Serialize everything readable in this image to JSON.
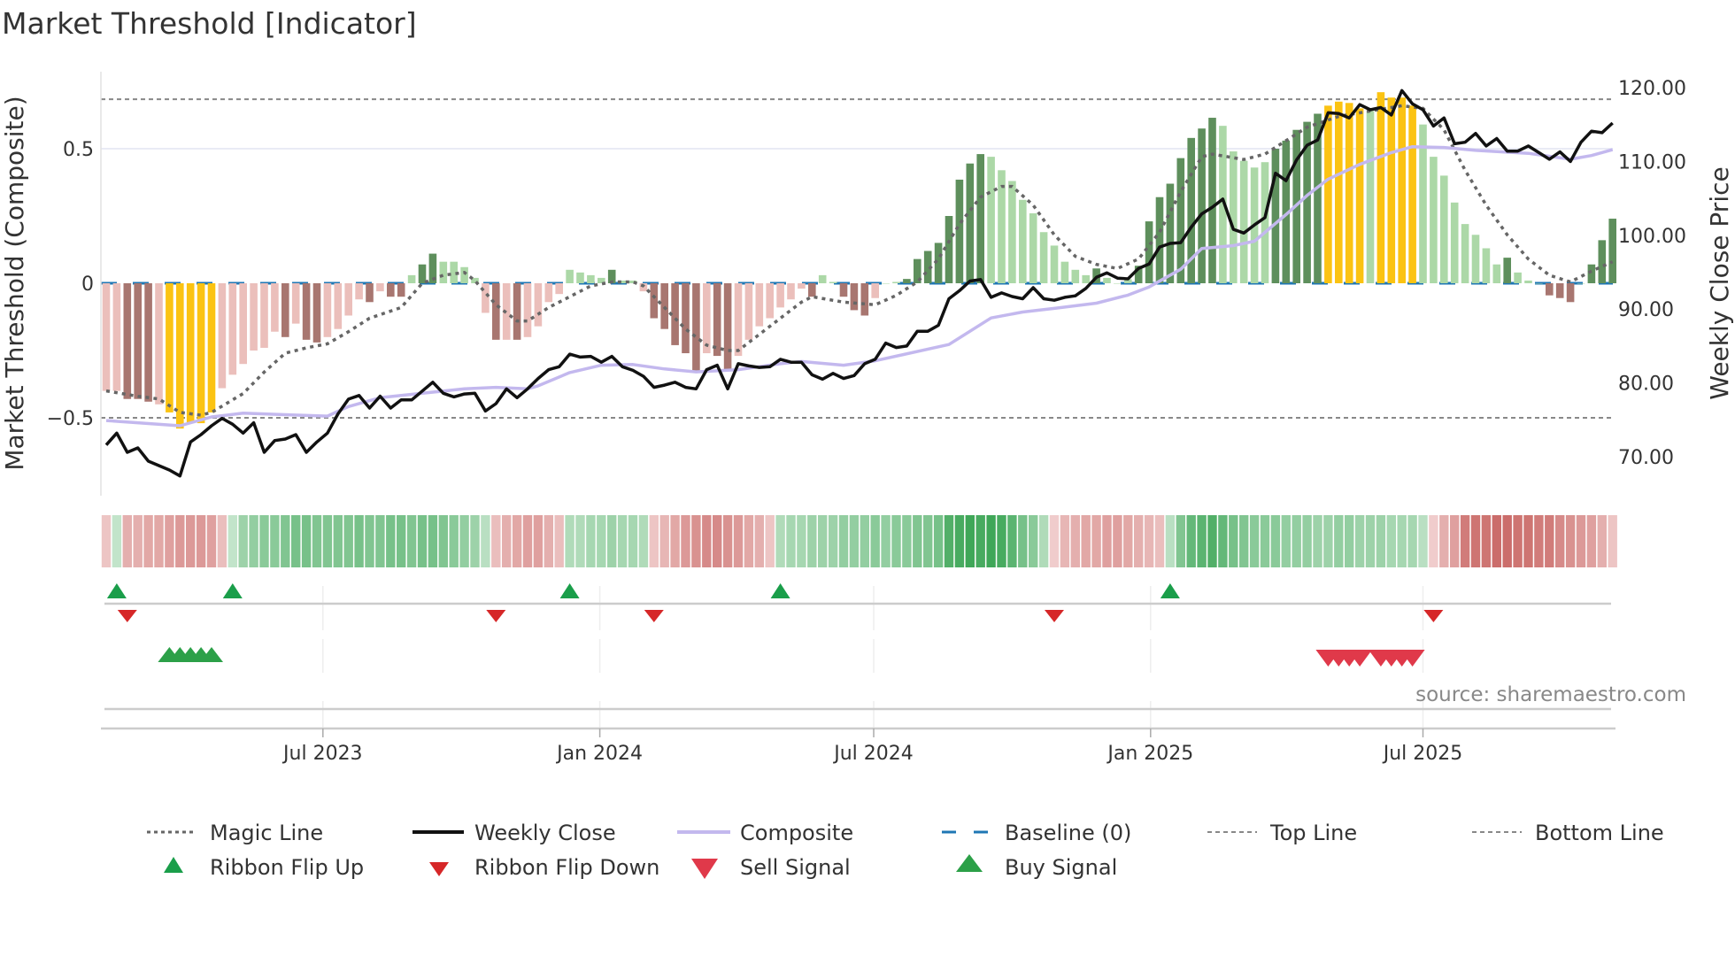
{
  "title": "Market Threshold [Indicator]",
  "source": "source: sharemaestro.com",
  "chart_data": {
    "type": "bar+line",
    "title": "Market Threshold [Indicator]",
    "x_start": "2023-02-07",
    "x_interval_days": 7,
    "xticks": [
      {
        "label": "Jul 2023",
        "date": "2023-07-01"
      },
      {
        "label": "Jan 2024",
        "date": "2024-01-01"
      },
      {
        "label": "Jul 2024",
        "date": "2024-07-01"
      },
      {
        "label": "Jan 2025",
        "date": "2025-01-01"
      },
      {
        "label": "Jul 2025",
        "date": "2025-07-01"
      }
    ],
    "ylabel_left": "Market Threshold (Composite)",
    "ylabel_right": "Weekly Close Price",
    "yticks_left": [
      {
        "v": 0.5,
        "label": "0.5"
      },
      {
        "v": 0,
        "label": "0"
      },
      {
        "v": -0.5,
        "label": "−0.5"
      }
    ],
    "yticks_right": [
      {
        "v": 120,
        "label": "120.00"
      },
      {
        "v": 110,
        "label": "110.00"
      },
      {
        "v": 100,
        "label": "100.00"
      },
      {
        "v": 90,
        "label": "90.00"
      },
      {
        "v": 80,
        "label": "80.00"
      },
      {
        "v": 70,
        "label": "70.00"
      }
    ],
    "ylim_left": [
      -0.78,
      0.78
    ],
    "ylim_right": [
      64,
      122
    ],
    "top_line": 0.684,
    "bottom_line": -0.5,
    "baseline": 0,
    "bar_colors": {
      "L": "#ebbfbb",
      "D": "#a87670",
      "Y": "#fbc312",
      "g": "#acd8a7",
      "G": "#5e8f5c"
    },
    "bar_color_codes": "LLDDDLYYYYYLLLLLLDLDDLLLLDLDDgGGggggLDLDLLLLggggGggLDDDDDLDDLLLLLLLDggDDDLggGGGGGGGGggggggggggGgggGGGGGGGGgggggGGGGGYYYYgYYYYggggggggGgggDDDgGGG",
    "composite_bars": [
      -0.4,
      -0.4,
      -0.43,
      -0.43,
      -0.44,
      -0.45,
      -0.48,
      -0.54,
      -0.52,
      -0.52,
      -0.48,
      -0.39,
      -0.34,
      -0.3,
      -0.25,
      -0.24,
      -0.18,
      -0.2,
      -0.15,
      -0.21,
      -0.22,
      -0.2,
      -0.17,
      -0.12,
      -0.06,
      -0.07,
      -0.03,
      -0.05,
      -0.05,
      0.03,
      0.07,
      0.11,
      0.08,
      0.08,
      0.06,
      0.02,
      -0.11,
      -0.21,
      -0.21,
      -0.21,
      -0.2,
      -0.16,
      -0.07,
      -0.04,
      0.05,
      0.04,
      0.03,
      0.02,
      0.05,
      0.01,
      0.01,
      -0.03,
      -0.13,
      -0.17,
      -0.23,
      -0.26,
      -0.33,
      -0.26,
      -0.27,
      -0.32,
      -0.27,
      -0.21,
      -0.16,
      -0.13,
      -0.09,
      -0.06,
      -0.02,
      -0.05,
      0.03,
      0.005,
      -0.05,
      -0.1,
      -0.12,
      -0.055,
      0.0,
      0.005,
      0.016,
      0.09,
      0.12,
      0.15,
      0.25,
      0.385,
      0.445,
      0.48,
      0.47,
      0.42,
      0.38,
      0.31,
      0.26,
      0.19,
      0.14,
      0.08,
      0.05,
      0.03,
      0.055,
      0.02,
      0.0,
      0.015,
      0.065,
      0.23,
      0.32,
      0.37,
      0.465,
      0.54,
      0.575,
      0.615,
      0.585,
      0.49,
      0.455,
      0.43,
      0.45,
      0.5,
      0.53,
      0.57,
      0.6,
      0.63,
      0.66,
      0.675,
      0.67,
      0.65,
      0.64,
      0.71,
      0.69,
      0.69,
      0.66,
      0.59,
      0.47,
      0.4,
      0.3,
      0.22,
      0.18,
      0.13,
      0.07,
      0.095,
      0.04,
      0.01,
      0.0,
      -0.045,
      -0.055,
      -0.07,
      0.0,
      0.07,
      0.16,
      0.24
    ],
    "weekly_close": [
      71.6,
      73.2,
      70.6,
      71.2,
      69.4,
      68.8,
      68.2,
      67.4,
      72.0,
      73.0,
      74.2,
      75.2,
      74.4,
      73.2,
      74.6,
      70.6,
      72.2,
      72.4,
      73.0,
      70.6,
      72.0,
      73.2,
      75.8,
      77.8,
      78.3,
      76.6,
      78.2,
      76.6,
      77.7,
      77.7,
      78.9,
      80.1,
      78.6,
      78.1,
      78.5,
      78.6,
      76.2,
      77.2,
      79.2,
      78.0,
      79.2,
      80.6,
      81.8,
      82.2,
      83.9,
      83.5,
      83.6,
      82.8,
      83.6,
      82.2,
      81.7,
      80.9,
      79.4,
      79.7,
      80.1,
      79.4,
      79.2,
      81.8,
      82.4,
      79.2,
      82.6,
      82.3,
      82.1,
      82.2,
      83.2,
      82.8,
      82.8,
      81.1,
      80.5,
      81.3,
      80.6,
      81.0,
      82.6,
      83.2,
      85.4,
      84.8,
      85.0,
      87.0,
      87.0,
      87.8,
      91.4,
      92.5,
      93.8,
      94.0,
      91.6,
      92.2,
      91.7,
      91.4,
      92.9,
      91.4,
      91.2,
      91.6,
      91.8,
      92.8,
      94.3,
      94.9,
      94.2,
      94.1,
      95.5,
      96.1,
      98.4,
      98.9,
      99.0,
      101.1,
      102.9,
      103.8,
      104.9,
      100.8,
      100.3,
      101.4,
      102.4,
      108.4,
      107.4,
      110.2,
      112.2,
      112.9,
      116.6,
      116.5,
      115.9,
      117.7,
      117.0,
      117.3,
      116.3,
      119.6,
      117.8,
      117.0,
      114.8,
      115.9,
      112.4,
      112.6,
      113.8,
      112.1,
      113.1,
      111.4,
      111.4,
      112.1,
      111.2,
      110.3,
      111.3,
      110.0,
      112.6,
      114.1,
      113.9,
      115.2
    ],
    "composite_line": [
      [
        0,
        74.9
      ],
      [
        7,
        74.2
      ],
      [
        10,
        75.4
      ],
      [
        13,
        75.9
      ],
      [
        17,
        75.7
      ],
      [
        21,
        75.5
      ],
      [
        23,
        76.8
      ],
      [
        26,
        78.0
      ],
      [
        30,
        78.6
      ],
      [
        34,
        79.2
      ],
      [
        37,
        79.4
      ],
      [
        40,
        79.2
      ],
      [
        41,
        79.6
      ],
      [
        44,
        81.4
      ],
      [
        47,
        82.4
      ],
      [
        50,
        82.5
      ],
      [
        53,
        81.9
      ],
      [
        56,
        81.5
      ],
      [
        60,
        81.8
      ],
      [
        64,
        82.6
      ],
      [
        66,
        82.9
      ],
      [
        70,
        82.4
      ],
      [
        73,
        83.0
      ],
      [
        80,
        85.2
      ],
      [
        84,
        88.8
      ],
      [
        87,
        89.6
      ],
      [
        90,
        90.1
      ],
      [
        94,
        90.8
      ],
      [
        97,
        91.9
      ],
      [
        99,
        93.0
      ],
      [
        102,
        95.4
      ],
      [
        104,
        98.2
      ],
      [
        107,
        98.6
      ],
      [
        109,
        99.2
      ],
      [
        112,
        102.8
      ],
      [
        114,
        105.4
      ],
      [
        116,
        107.6
      ],
      [
        119,
        109.6
      ],
      [
        122,
        111.2
      ],
      [
        124,
        112.0
      ],
      [
        127,
        111.9
      ],
      [
        130,
        111.5
      ],
      [
        135,
        111.1
      ],
      [
        139,
        110.3
      ],
      [
        141,
        110.8
      ],
      [
        143,
        111.6
      ]
    ],
    "magic_line": [
      [
        0,
        -0.4
      ],
      [
        3,
        -0.42
      ],
      [
        5,
        -0.43
      ],
      [
        7,
        -0.48
      ],
      [
        9,
        -0.49
      ],
      [
        10,
        -0.48
      ],
      [
        13,
        -0.41
      ],
      [
        15,
        -0.33
      ],
      [
        17,
        -0.26
      ],
      [
        19,
        -0.24
      ],
      [
        21,
        -0.225
      ],
      [
        23,
        -0.18
      ],
      [
        25,
        -0.13
      ],
      [
        28,
        -0.09
      ],
      [
        30,
        0.0
      ],
      [
        32,
        0.03
      ],
      [
        34,
        0.04
      ],
      [
        35,
        0.01
      ],
      [
        37,
        -0.08
      ],
      [
        39,
        -0.14
      ],
      [
        40,
        -0.14
      ],
      [
        42,
        -0.09
      ],
      [
        44,
        -0.05
      ],
      [
        46,
        -0.01
      ],
      [
        48,
        0.005
      ],
      [
        50,
        0.005
      ],
      [
        51,
        -0.01
      ],
      [
        53,
        -0.09
      ],
      [
        55,
        -0.17
      ],
      [
        57,
        -0.23
      ],
      [
        59,
        -0.25
      ],
      [
        60,
        -0.25
      ],
      [
        62,
        -0.19
      ],
      [
        64,
        -0.13
      ],
      [
        66,
        -0.07
      ],
      [
        67,
        -0.05
      ],
      [
        70,
        -0.07
      ],
      [
        73,
        -0.08
      ],
      [
        75,
        -0.045
      ],
      [
        77,
        0.005
      ],
      [
        79,
        0.09
      ],
      [
        81,
        0.22
      ],
      [
        83,
        0.32
      ],
      [
        85,
        0.36
      ],
      [
        86,
        0.36
      ],
      [
        88,
        0.29
      ],
      [
        90,
        0.18
      ],
      [
        92,
        0.1
      ],
      [
        94,
        0.07
      ],
      [
        96,
        0.055
      ],
      [
        98,
        0.09
      ],
      [
        100,
        0.19
      ],
      [
        102,
        0.34
      ],
      [
        104,
        0.47
      ],
      [
        105,
        0.48
      ],
      [
        108,
        0.46
      ],
      [
        110,
        0.48
      ],
      [
        112,
        0.53
      ],
      [
        114,
        0.58
      ],
      [
        117,
        0.62
      ],
      [
        120,
        0.64
      ],
      [
        123,
        0.66
      ],
      [
        125,
        0.65
      ],
      [
        127,
        0.57
      ],
      [
        129,
        0.42
      ],
      [
        131,
        0.29
      ],
      [
        133,
        0.18
      ],
      [
        135,
        0.09
      ],
      [
        137,
        0.03
      ],
      [
        139,
        0.005
      ],
      [
        141,
        0.045
      ],
      [
        143,
        0.08
      ]
    ],
    "ribbon": [
      -0.2,
      0.2,
      -0.35,
      -0.35,
      -0.4,
      -0.4,
      -0.45,
      -0.5,
      -0.5,
      -0.5,
      -0.45,
      -0.25,
      0.2,
      0.4,
      0.45,
      0.5,
      0.5,
      0.55,
      0.6,
      0.6,
      0.55,
      0.55,
      0.55,
      0.55,
      0.6,
      0.55,
      0.55,
      0.6,
      0.6,
      0.55,
      0.6,
      0.6,
      0.55,
      0.5,
      0.45,
      0.4,
      0.25,
      -0.25,
      -0.35,
      -0.4,
      -0.45,
      -0.45,
      -0.35,
      -0.25,
      0.3,
      0.3,
      0.35,
      0.35,
      0.4,
      0.35,
      0.35,
      0.3,
      -0.2,
      -0.3,
      -0.4,
      -0.5,
      -0.55,
      -0.6,
      -0.6,
      -0.55,
      -0.5,
      -0.4,
      -0.35,
      -0.2,
      0.3,
      0.35,
      0.35,
      0.4,
      0.4,
      0.4,
      0.45,
      0.45,
      0.45,
      0.5,
      0.45,
      0.5,
      0.5,
      0.55,
      0.55,
      0.6,
      0.8,
      0.85,
      0.9,
      0.85,
      0.9,
      0.85,
      0.75,
      0.6,
      0.5,
      0.3,
      -0.15,
      -0.3,
      -0.35,
      -0.4,
      -0.4,
      -0.45,
      -0.45,
      -0.4,
      -0.35,
      -0.3,
      -0.25,
      0.25,
      0.55,
      0.7,
      0.75,
      0.8,
      0.7,
      0.6,
      0.55,
      0.5,
      0.5,
      0.5,
      0.45,
      0.45,
      0.45,
      0.4,
      0.4,
      0.45,
      0.45,
      0.4,
      0.4,
      0.4,
      0.35,
      0.35,
      0.35,
      0.25,
      -0.15,
      -0.35,
      -0.45,
      -0.7,
      -0.75,
      -0.75,
      -0.8,
      -0.8,
      -0.75,
      -0.75,
      -0.7,
      -0.7,
      -0.6,
      -0.55,
      -0.5,
      -0.45,
      -0.35,
      -0.2
    ],
    "ribbon_flip_up": [
      1,
      12,
      44,
      64,
      101
    ],
    "ribbon_flip_down": [
      2,
      37,
      52,
      90,
      126
    ],
    "buy_signals": [
      6,
      7,
      8,
      9,
      10
    ],
    "sell_signals": [
      116,
      117,
      118,
      119,
      121,
      122,
      123,
      124
    ],
    "colors": {
      "weekly_close": "#111111",
      "composite": "#c3b8ee",
      "magic": "#666666",
      "baseline": "#1f77b4",
      "ref_lines": "#888888",
      "flip_up": "#1a9e4a",
      "flip_down": "#d62728",
      "buy": "#2ca048",
      "sell": "#e0394a"
    },
    "legend": [
      {
        "label": "Magic Line",
        "symbol": "dotted-gray"
      },
      {
        "label": "Weekly Close",
        "symbol": "solid-black"
      },
      {
        "label": "Composite",
        "symbol": "solid-lavender"
      },
      {
        "label": "Baseline (0)",
        "symbol": "dashed-blue"
      },
      {
        "label": "Top Line",
        "symbol": "dotted-thin"
      },
      {
        "label": "Bottom Line",
        "symbol": "dotted-thin"
      },
      {
        "label": "Ribbon Flip Up",
        "symbol": "triangle-up-green"
      },
      {
        "label": "Ribbon Flip Down",
        "symbol": "triangle-down-red"
      },
      {
        "label": "Sell Signal",
        "symbol": "triangle-down-pink"
      },
      {
        "label": "Buy Signal",
        "symbol": "triangle-up-green-large"
      }
    ],
    "legend_placement": "bottom"
  }
}
